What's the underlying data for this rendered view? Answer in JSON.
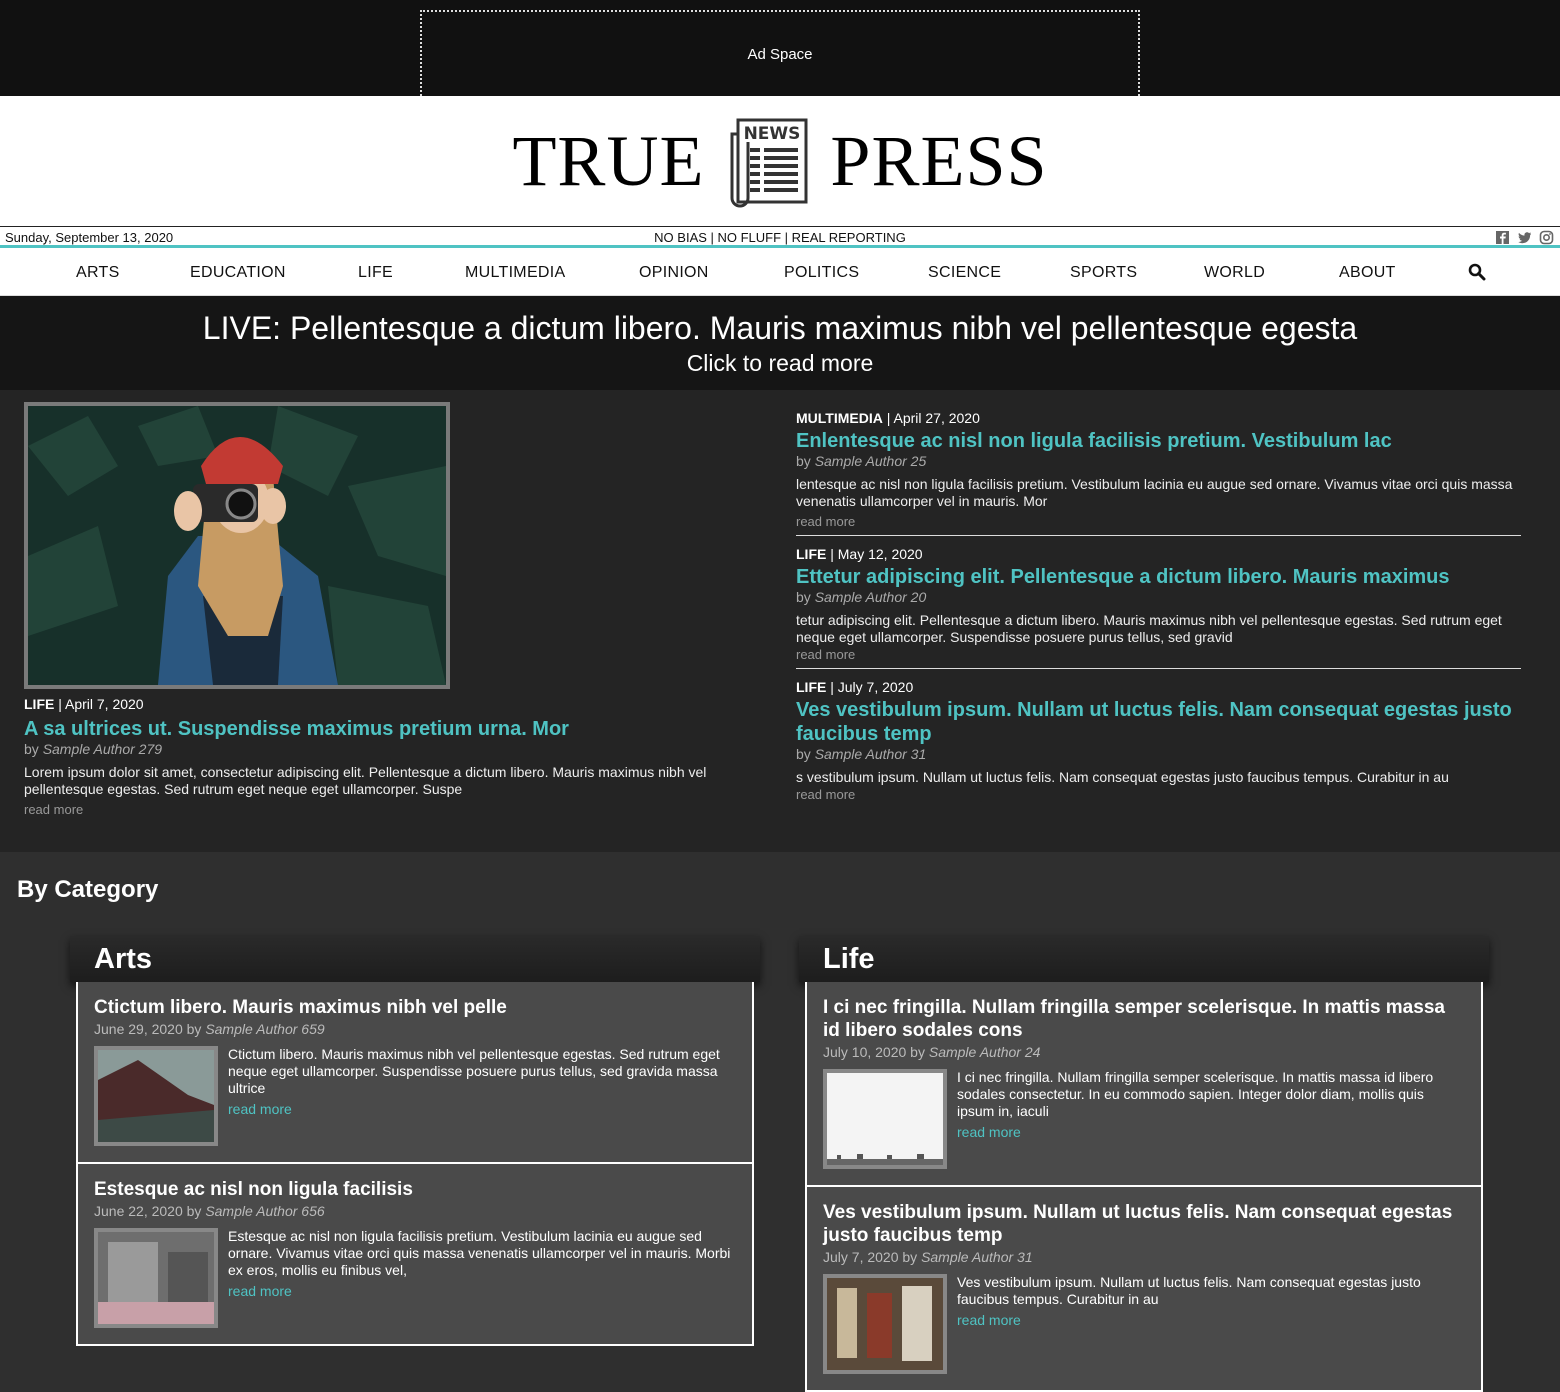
{
  "ad": {
    "label": "Ad Space"
  },
  "masthead": {
    "left_word": "TRUE",
    "right_word": "PRESS",
    "logo_text": "NEWS"
  },
  "infostrip": {
    "date": "Sunday, September 13, 2020",
    "tagline": "NO BIAS | NO FLUFF | REAL REPORTING"
  },
  "social": [
    "facebook-icon",
    "twitter-icon",
    "instagram-icon"
  ],
  "nav": [
    "ARTS",
    "EDUCATION",
    "LIFE",
    "MULTIMEDIA",
    "OPINION",
    "POLITICS",
    "SCIENCE",
    "SPORTS",
    "WORLD",
    "ABOUT"
  ],
  "live": {
    "headline": "LIVE: Pellentesque a dictum libero. Mauris maximus nibh vel pellentesque egesta",
    "sub": "Click to read more"
  },
  "hero": {
    "category": "LIFE",
    "date": " | April 7, 2020",
    "title": "A sa ultrices ut. Suspendisse maximus pretium urna. Mor",
    "by": "by ",
    "author": "Sample Author 279",
    "excerpt": "Lorem ipsum dolor sit amet, consectetur adipiscing elit. Pellentesque a dictum libero. Mauris maximus nibh vel pellentesque egestas. Sed rutrum eget neque eget ullamcorper. Suspe",
    "read_more": "read more"
  },
  "side_stories": [
    {
      "category": "MULTIMEDIA",
      "date": " | April 27, 2020",
      "title": "Enlentesque ac nisl non ligula facilisis pretium. Vestibulum lac",
      "by": "by ",
      "author": "Sample Author 25",
      "excerpt": "lentesque ac nisl non ligula facilisis pretium. Vestibulum lacinia eu augue sed ornare. Vivamus vitae orci quis massa venenatis ullamcorper vel in mauris. Mor",
      "read_more": "read more"
    },
    {
      "category": "LIFE",
      "date": " | May 12, 2020",
      "title": "Ettetur adipiscing elit. Pellentesque a dictum libero. Mauris maximus",
      "by": "by ",
      "author": "Sample Author 20",
      "excerpt": "tetur adipiscing elit. Pellentesque a dictum libero. Mauris maximus nibh vel pellentesque egestas. Sed rutrum eget neque eget ullamcorper. Suspendisse posuere purus tellus, sed gravid",
      "read_more": "read more"
    },
    {
      "category": "LIFE",
      "date": " | July 7, 2020",
      "title": "Ves vestibulum ipsum. Nullam ut luctus felis. Nam consequat egestas justo faucibus temp",
      "by": "by ",
      "author": "Sample Author 31",
      "excerpt": "s vestibulum ipsum. Nullam ut luctus felis. Nam consequat egestas justo faucibus tempus. Curabitur in au",
      "read_more": "read more"
    }
  ],
  "by_category": {
    "heading": "By Category"
  },
  "categories": [
    {
      "name": "Arts",
      "items": [
        {
          "title": "Ctictum libero. Mauris maximus nibh vel pelle",
          "date": "June 29, 2020 by ",
          "author": "Sample Author 659",
          "excerpt": "Ctictum libero. Mauris maximus nibh vel pellentesque egestas. Sed rutrum eget neque eget ullamcorper. Suspendisse posuere purus tellus, sed gravida massa ultrice",
          "read_more": "read more"
        },
        {
          "title": "Estesque ac nisl non ligula facilisis",
          "date": "June 22, 2020 by ",
          "author": "Sample Author 656",
          "excerpt": "Estesque ac nisl non ligula facilisis pretium. Vestibulum lacinia eu augue sed ornare. Vivamus vitae orci quis massa venenatis ullamcorper vel in mauris. Morbi ex eros, mollis eu finibus vel,",
          "read_more": "read more"
        }
      ]
    },
    {
      "name": "Life",
      "items": [
        {
          "title": "I ci nec fringilla. Nullam fringilla semper scelerisque. In mattis massa id libero sodales cons",
          "date": "July 10, 2020 by ",
          "author": "Sample Author 24",
          "excerpt": "I ci nec fringilla. Nullam fringilla semper scelerisque. In mattis massa id libero sodales consectetur. In eu commodo sapien. Integer dolor diam, mollis quis ipsum in, iaculi",
          "read_more": "read more"
        },
        {
          "title": "Ves vestibulum ipsum. Nullam ut luctus felis. Nam consequat egestas justo faucibus temp",
          "date": "July 7, 2020 by ",
          "author": "Sample Author 31",
          "excerpt": "Ves vestibulum ipsum. Nullam ut luctus felis. Nam consequat egestas justo faucibus tempus. Curabitur in au",
          "read_more": "read more"
        }
      ]
    }
  ],
  "colors": {
    "accent": "#4fc3c3",
    "background": "#2f2f2f",
    "featured_bg": "#242424",
    "live_bg": "#151515"
  }
}
